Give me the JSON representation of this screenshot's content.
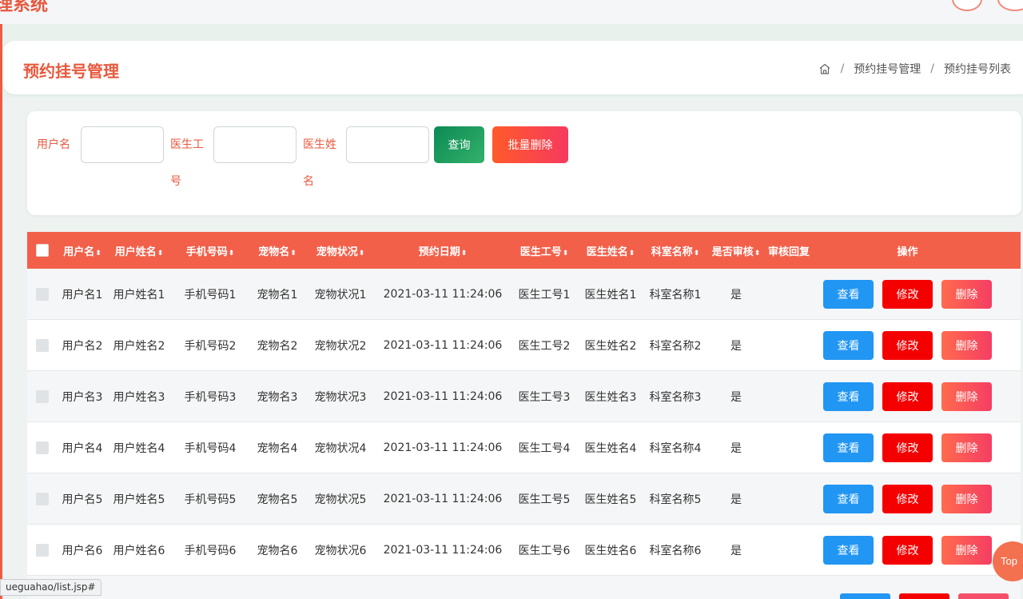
{
  "app": {
    "title": "理系统"
  },
  "header": {
    "title": "预约挂号管理",
    "breadcrumb": [
      "预约挂号管理",
      "预约挂号列表"
    ]
  },
  "search": {
    "username_label": "用户名",
    "doctor_no_label": "医生工号",
    "doctor_name_label": "医生姓名",
    "username_value": "",
    "doctor_no_value": "",
    "doctor_name_value": "",
    "query_button": "查询",
    "batch_delete_button": "批量删除"
  },
  "table": {
    "columns": [
      "用户名",
      "用户姓名",
      "手机号码",
      "宠物名",
      "宠物状况",
      "预约日期",
      "医生工号",
      "医生姓名",
      "科室名称",
      "是否审核",
      "审核回复",
      "操作"
    ],
    "sort_indicator": "⬍",
    "rows": [
      {
        "user": "用户名1",
        "name": "用户姓名1",
        "phone": "手机号码1",
        "pet": "宠物名1",
        "pet_status": "宠物状况1",
        "date": "2021-03-11 11:24:06",
        "doc_no": "医生工号1",
        "doc_name": "医生姓名1",
        "dept": "科室名称1",
        "audit": "是",
        "reply": ""
      },
      {
        "user": "用户名2",
        "name": "用户姓名2",
        "phone": "手机号码2",
        "pet": "宠物名2",
        "pet_status": "宠物状况2",
        "date": "2021-03-11 11:24:06",
        "doc_no": "医生工号2",
        "doc_name": "医生姓名2",
        "dept": "科室名称2",
        "audit": "是",
        "reply": ""
      },
      {
        "user": "用户名3",
        "name": "用户姓名3",
        "phone": "手机号码3",
        "pet": "宠物名3",
        "pet_status": "宠物状况3",
        "date": "2021-03-11 11:24:06",
        "doc_no": "医生工号3",
        "doc_name": "医生姓名3",
        "dept": "科室名称3",
        "audit": "是",
        "reply": ""
      },
      {
        "user": "用户名4",
        "name": "用户姓名4",
        "phone": "手机号码4",
        "pet": "宠物名4",
        "pet_status": "宠物状况4",
        "date": "2021-03-11 11:24:06",
        "doc_no": "医生工号4",
        "doc_name": "医生姓名4",
        "dept": "科室名称4",
        "audit": "是",
        "reply": ""
      },
      {
        "user": "用户名5",
        "name": "用户姓名5",
        "phone": "手机号码5",
        "pet": "宠物名5",
        "pet_status": "宠物状况5",
        "date": "2021-03-11 11:24:06",
        "doc_no": "医生工号5",
        "doc_name": "医生姓名5",
        "dept": "科室名称5",
        "audit": "是",
        "reply": ""
      },
      {
        "user": "用户名6",
        "name": "用户姓名6",
        "phone": "手机号码6",
        "pet": "宠物名6",
        "pet_status": "宠物状况6",
        "date": "2021-03-11 11:24:06",
        "doc_no": "医生工号6",
        "doc_name": "医生姓名6",
        "dept": "科室名称6",
        "audit": "是",
        "reply": ""
      }
    ],
    "actions": {
      "view": "查看",
      "edit": "修改",
      "delete": "删除"
    }
  },
  "status_bar": {
    "url": "ueguahao/list.jsp#"
  },
  "back_to_top": {
    "label": "Top"
  },
  "colors": {
    "accent": "#e7593e",
    "table_header": "#f2604a",
    "view": "#2196f3",
    "edit": "#f40000",
    "query": "#1a9a5e"
  },
  "icons": {
    "breadcrumb_home": "home-icon"
  }
}
